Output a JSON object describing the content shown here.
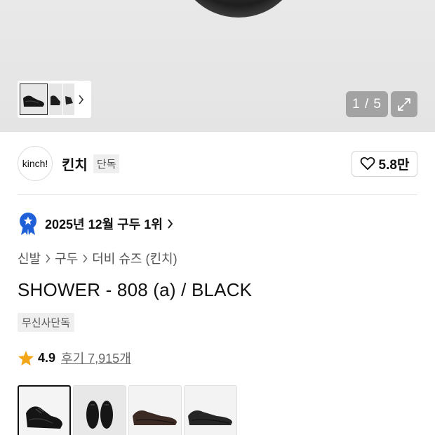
{
  "gallery": {
    "counter": "1 / 5",
    "thumbnails": [
      "black-derby-shoe-thumb",
      "black-shoe-side-thumb",
      "black-shoe-angle-thumb"
    ],
    "icons": {
      "next": "chevron-right-icon",
      "expand": "expand-icon"
    }
  },
  "brand": {
    "logo_text": "kinch!",
    "name": "킨치",
    "tag": "단독",
    "likes": "5.8만"
  },
  "ranking": {
    "text": "2025년 12월 구두 1위"
  },
  "breadcrumb": [
    "신발",
    "구두",
    "더비 슈즈 (킨치)"
  ],
  "product": {
    "title": "SHOWER - 808 (a) / BLACK",
    "exclusive_tag": "무신사단독",
    "rating": "4.9",
    "reviews": "후기 7,915개"
  },
  "options": [
    {
      "name": "black-derby-shoe-option",
      "selected": true
    },
    {
      "name": "black-pair-front-option",
      "selected": false
    },
    {
      "name": "brown-derby-shoe-option",
      "selected": false
    },
    {
      "name": "black-suede-derby-option",
      "selected": false
    }
  ],
  "colors": {
    "badge_blue": "#1f5fd8",
    "star": "#f2a516",
    "overlay_gray": "#a3a3a3"
  }
}
